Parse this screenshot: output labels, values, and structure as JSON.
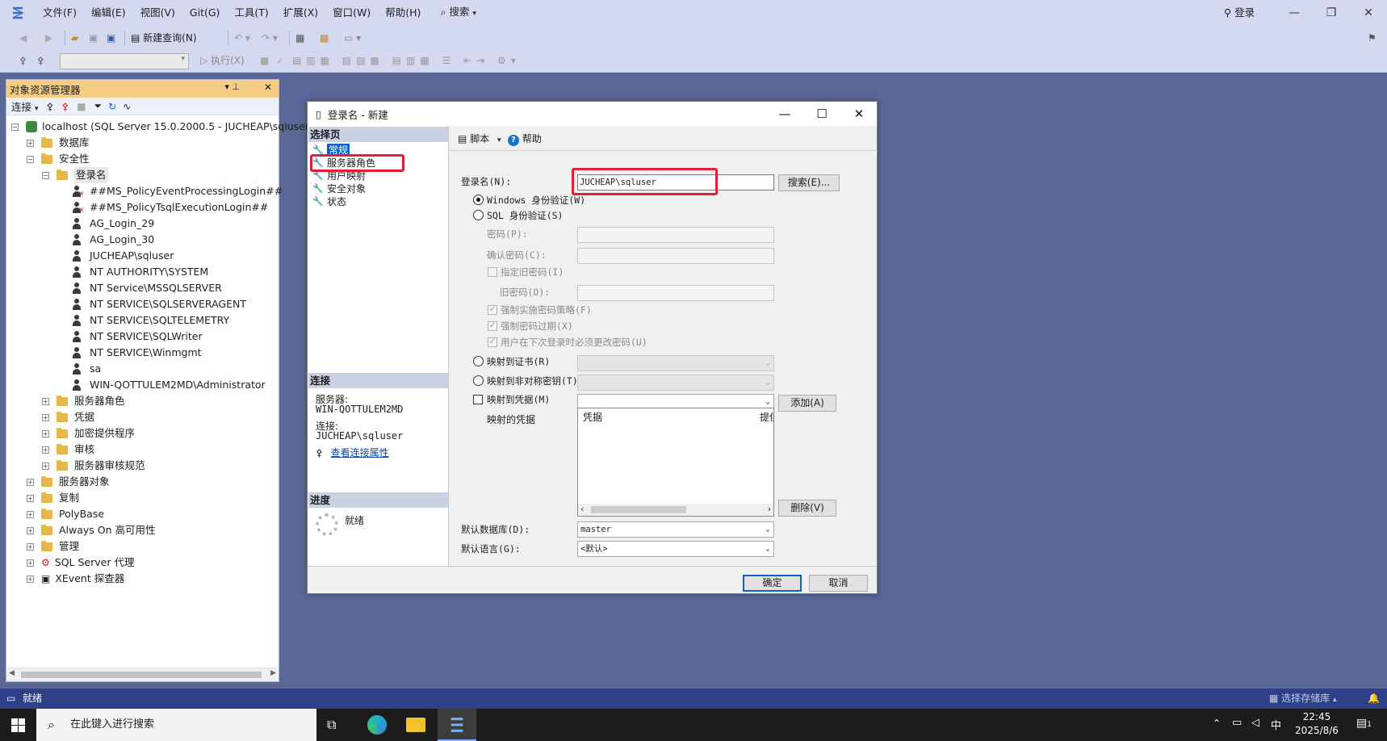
{
  "menubar": {
    "items": [
      "文件(F)",
      "编辑(E)",
      "视图(V)",
      "Git(G)",
      "工具(T)",
      "扩展(X)",
      "窗口(W)",
      "帮助(H)"
    ],
    "search_label": "搜索",
    "login_label": "登录"
  },
  "toolbar": {
    "new_query": "新建查询(N)",
    "execute": "执行(X)"
  },
  "object_explorer": {
    "title": "对象资源管理器",
    "connect_label": "连接",
    "server_node": "localhost (SQL Server 15.0.2000.5 - JUCHEAP\\sqluser",
    "nodes": {
      "databases": "数据库",
      "security": "安全性",
      "logins": "登录名",
      "login_items": [
        "##MS_PolicyEventProcessingLogin##",
        "##MS_PolicyTsqlExecutionLogin##",
        "AG_Login_29",
        "AG_Login_30",
        "JUCHEAP\\sqluser",
        "NT AUTHORITY\\SYSTEM",
        "NT Service\\MSSQLSERVER",
        "NT SERVICE\\SQLSERVERAGENT",
        "NT SERVICE\\SQLTELEMETRY",
        "NT SERVICE\\SQLWriter",
        "NT SERVICE\\Winmgmt",
        "sa",
        "WIN-QOTTULEM2MD\\Administrator"
      ],
      "security_children": [
        "服务器角色",
        "凭据",
        "加密提供程序",
        "审核",
        "服务器审核规范"
      ],
      "top_children": [
        "服务器对象",
        "复制",
        "PolyBase",
        "Always On 高可用性",
        "管理",
        "SQL Server 代理",
        "XEvent 探查器"
      ]
    }
  },
  "dialog": {
    "title": "登录名 - 新建",
    "select_page_header": "选择页",
    "pages": [
      "常规",
      "服务器角色",
      "用户映射",
      "安全对象",
      "状态"
    ],
    "connection_header": "连接",
    "server_label": "服务器:",
    "server_value": "WIN-QOTTULEM2MD",
    "connection_label": "连接:",
    "connection_value": "JUCHEAP\\sqluser",
    "view_connection_link": "查看连接属性",
    "progress_header": "进度",
    "progress_status": "就绪",
    "script_label": "脚本",
    "help_label": "帮助",
    "login_name_label": "登录名(N):",
    "login_name_value": "JUCHEAP\\sqluser",
    "search_button": "搜索(E)...",
    "windows_auth": "Windows 身份验证(W)",
    "sql_auth": "SQL 身份验证(S)",
    "password_label": "密码(P):",
    "confirm_password_label": "确认密码(C):",
    "specify_old_password": "指定旧密码(I)",
    "old_password_label": "旧密码(O):",
    "enforce_policy": "强制实施密码策略(F)",
    "enforce_expiration": "强制密码过期(X)",
    "must_change": "用户在下次登录时必须更改密码(U)",
    "map_certificate": "映射到证书(R)",
    "map_asymmetric_key": "映射到非对称密钥(T)",
    "map_credential": "映射到凭据(M)",
    "add_button": "添加(A)",
    "mapped_credentials_label": "映射的凭据",
    "credential_columns": [
      "凭据",
      "提供"
    ],
    "remove_button": "删除(V)",
    "default_database_label": "默认数据库(D):",
    "default_database_value": "master",
    "default_language_label": "默认语言(G):",
    "default_language_value": "<默认>",
    "ok_button": "确定",
    "cancel_button": "取消"
  },
  "statusbar": {
    "status": "就绪",
    "repo_label": "选择存储库"
  },
  "taskbar": {
    "search_placeholder": "在此键入进行搜索",
    "ime": "中",
    "time": "22:45",
    "date": "2025/8/6",
    "notification_count": "1"
  },
  "colors": {
    "accent_red": "#e0203a",
    "oe_title_bg": "#f5cc84",
    "status_bar": "#2e4188"
  }
}
